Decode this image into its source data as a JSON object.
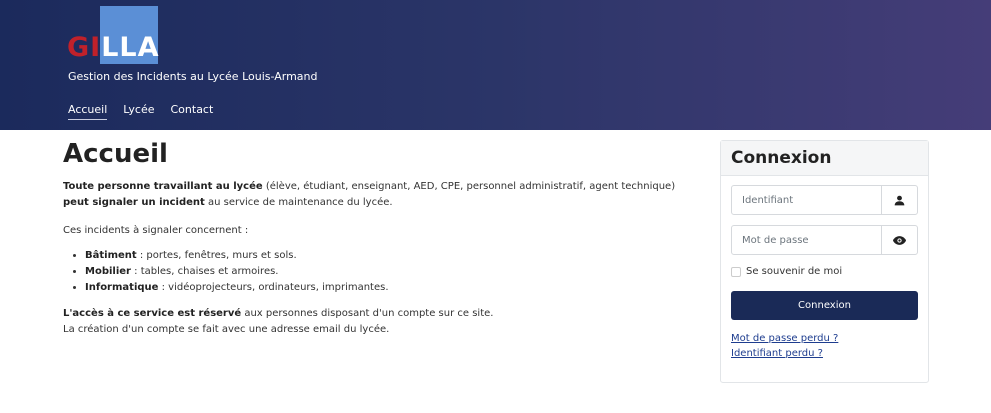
{
  "header": {
    "logo_part1": "GI",
    "logo_part2": "LLA",
    "tagline": "Gestion des Incidents au Lycée Louis-Armand",
    "nav": [
      "Accueil",
      "Lycée",
      "Contact"
    ],
    "colors": {
      "logo_red": "#c0212a",
      "logo_blue": "#5b8fd6",
      "banner_start": "#1b2a5c",
      "banner_end": "#453d78"
    }
  },
  "main": {
    "title": "Accueil",
    "intro_bold1": "Toute personne travaillant au lycée",
    "intro_text1": " (élève, étudiant, enseignant, AED, CPE, personnel administratif, agent technique) ",
    "intro_bold2": "peut signaler un incident",
    "intro_text2": " au service de maintenance du lycée.",
    "concern": "Ces incidents à signaler concernent :",
    "items": [
      {
        "label": "Bâtiment",
        "text": " : portes, fenêtres, murs et sols."
      },
      {
        "label": "Mobilier",
        "text": " : tables, chaises et armoires."
      },
      {
        "label": "Informatique",
        "text": " : vidéoprojecteurs, ordinateurs, imprimantes."
      }
    ],
    "access_bold": "L'accès à ce service est réservé",
    "access_text": " aux personnes disposant d'un compte sur ce site.",
    "account_text": "La création d'un compte se fait avec une adresse email du lycée."
  },
  "login": {
    "title": "Connexion",
    "username_placeholder": "Identifiant",
    "password_placeholder": "Mot de passe",
    "user_icon": "user-icon",
    "eye_icon": "eye-icon",
    "remember": "Se souvenir de moi",
    "submit": "Connexion",
    "lost_password": "Mot de passe perdu ?",
    "lost_username": "Identifiant perdu ?",
    "button_color": "#1a2a57"
  }
}
